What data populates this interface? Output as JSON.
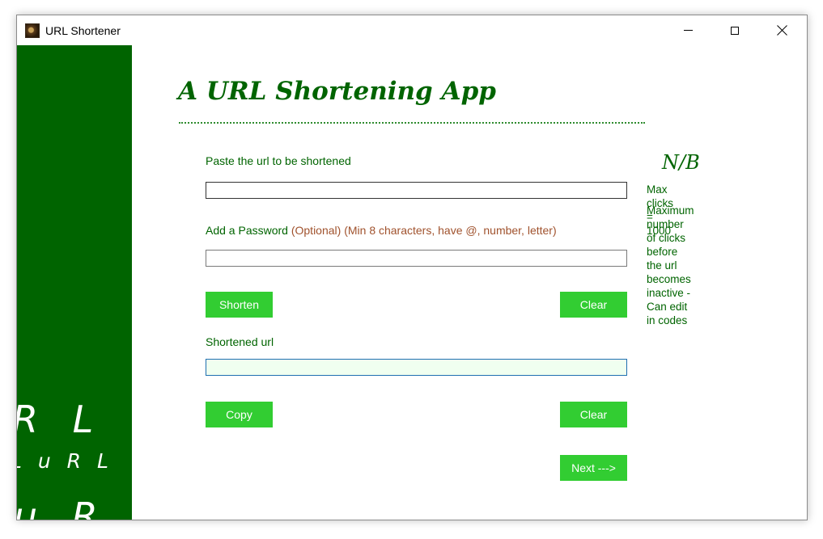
{
  "window": {
    "title": "URL Shortener",
    "controls": {
      "minimize": "minimize",
      "maximize": "maximize",
      "close": "close"
    }
  },
  "sidebar": {
    "bg_color": "#006400",
    "decorations": [
      "R L",
      "L   u R L",
      "u R L"
    ]
  },
  "main": {
    "heading": "A URL Shortening App",
    "url_field": {
      "label": "Paste the url to be shortened",
      "value": ""
    },
    "password_field": {
      "label": "Add a Password",
      "hint": "(Optional)  (Min 8 characters, have @, number, letter)",
      "value": ""
    },
    "shorten_button": "Shorten",
    "clear_button_top": "Clear",
    "output_field": {
      "label": "Shortened url",
      "value": ""
    },
    "copy_button": "Copy",
    "clear_button_bottom": "Clear",
    "next_button": "Next --->"
  },
  "notes": {
    "title": "N/B",
    "max_clicks": "Max clicks = 1000",
    "description_lines": [
      "Maximum number of clicks",
      "before the url becomes",
      "inactive - Can edit in codes"
    ]
  },
  "colors": {
    "accent_green": "#006400",
    "button_green": "#32cd32",
    "hint_brown": "#a0522d",
    "output_bg": "#f0fff0"
  }
}
